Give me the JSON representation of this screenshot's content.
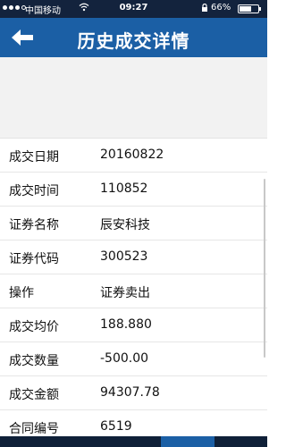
{
  "status_bar": {
    "carrier": "中国移动",
    "time": "09:27",
    "battery": "66%",
    "battery_level": 0.66,
    "icons": [
      "signal-dots-icon",
      "wifi-icon",
      "lock-rotation-icon",
      "battery-icon"
    ]
  },
  "nav": {
    "back_icon": "back-arrow-icon",
    "title": "历史成交详情"
  },
  "details": [
    {
      "label": "成交日期",
      "value": "20160822"
    },
    {
      "label": "成交时间",
      "value": "110852"
    },
    {
      "label": "证券名称",
      "value": "辰安科技"
    },
    {
      "label": "证券代码",
      "value": "300523"
    },
    {
      "label": "操作",
      "value": "证券卖出"
    },
    {
      "label": "成交均价",
      "value": "188.880"
    },
    {
      "label": "成交数量",
      "value": "-500.00"
    },
    {
      "label": "成交金额",
      "value": "94307.78"
    },
    {
      "label": "合同编号",
      "value": "6519"
    }
  ],
  "colors": {
    "status_bar": "#13233d",
    "nav_bar": "#1b5fa5",
    "tab_bar": "#0f2038"
  }
}
